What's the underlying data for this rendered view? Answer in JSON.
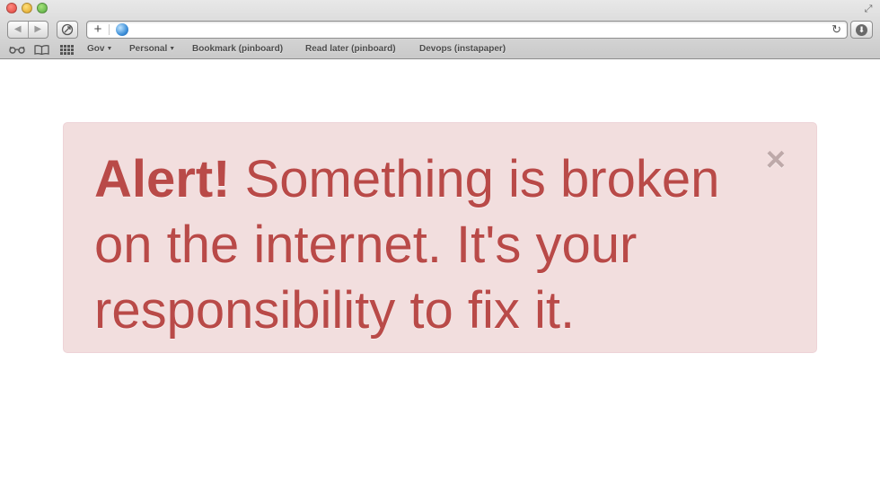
{
  "browser": {
    "address_bar": {
      "value": "",
      "placeholder": ""
    },
    "bookmarks": [
      {
        "label": "Gov",
        "has_menu": true
      },
      {
        "label": "Personal",
        "has_menu": true
      },
      {
        "label": "Bookmark (pinboard)",
        "has_menu": false
      },
      {
        "label": "Read later (pinboard)",
        "has_menu": false
      },
      {
        "label": "Devops (instapaper)",
        "has_menu": false
      }
    ],
    "glyphs": {
      "back": "◀",
      "forward": "▶",
      "add_tab": "+",
      "reload": "↻",
      "fullscreen": "⤢",
      "download": "⬇",
      "menu_caret": "▼"
    }
  },
  "alert": {
    "heading": "Alert!",
    "message": "Something is broken on the internet. It's your responsibility to fix it.",
    "close_glyph": "×"
  },
  "colors": {
    "alert_background": "#f2dede",
    "alert_text": "#b94a48",
    "alert_border": "#eed3d7"
  }
}
